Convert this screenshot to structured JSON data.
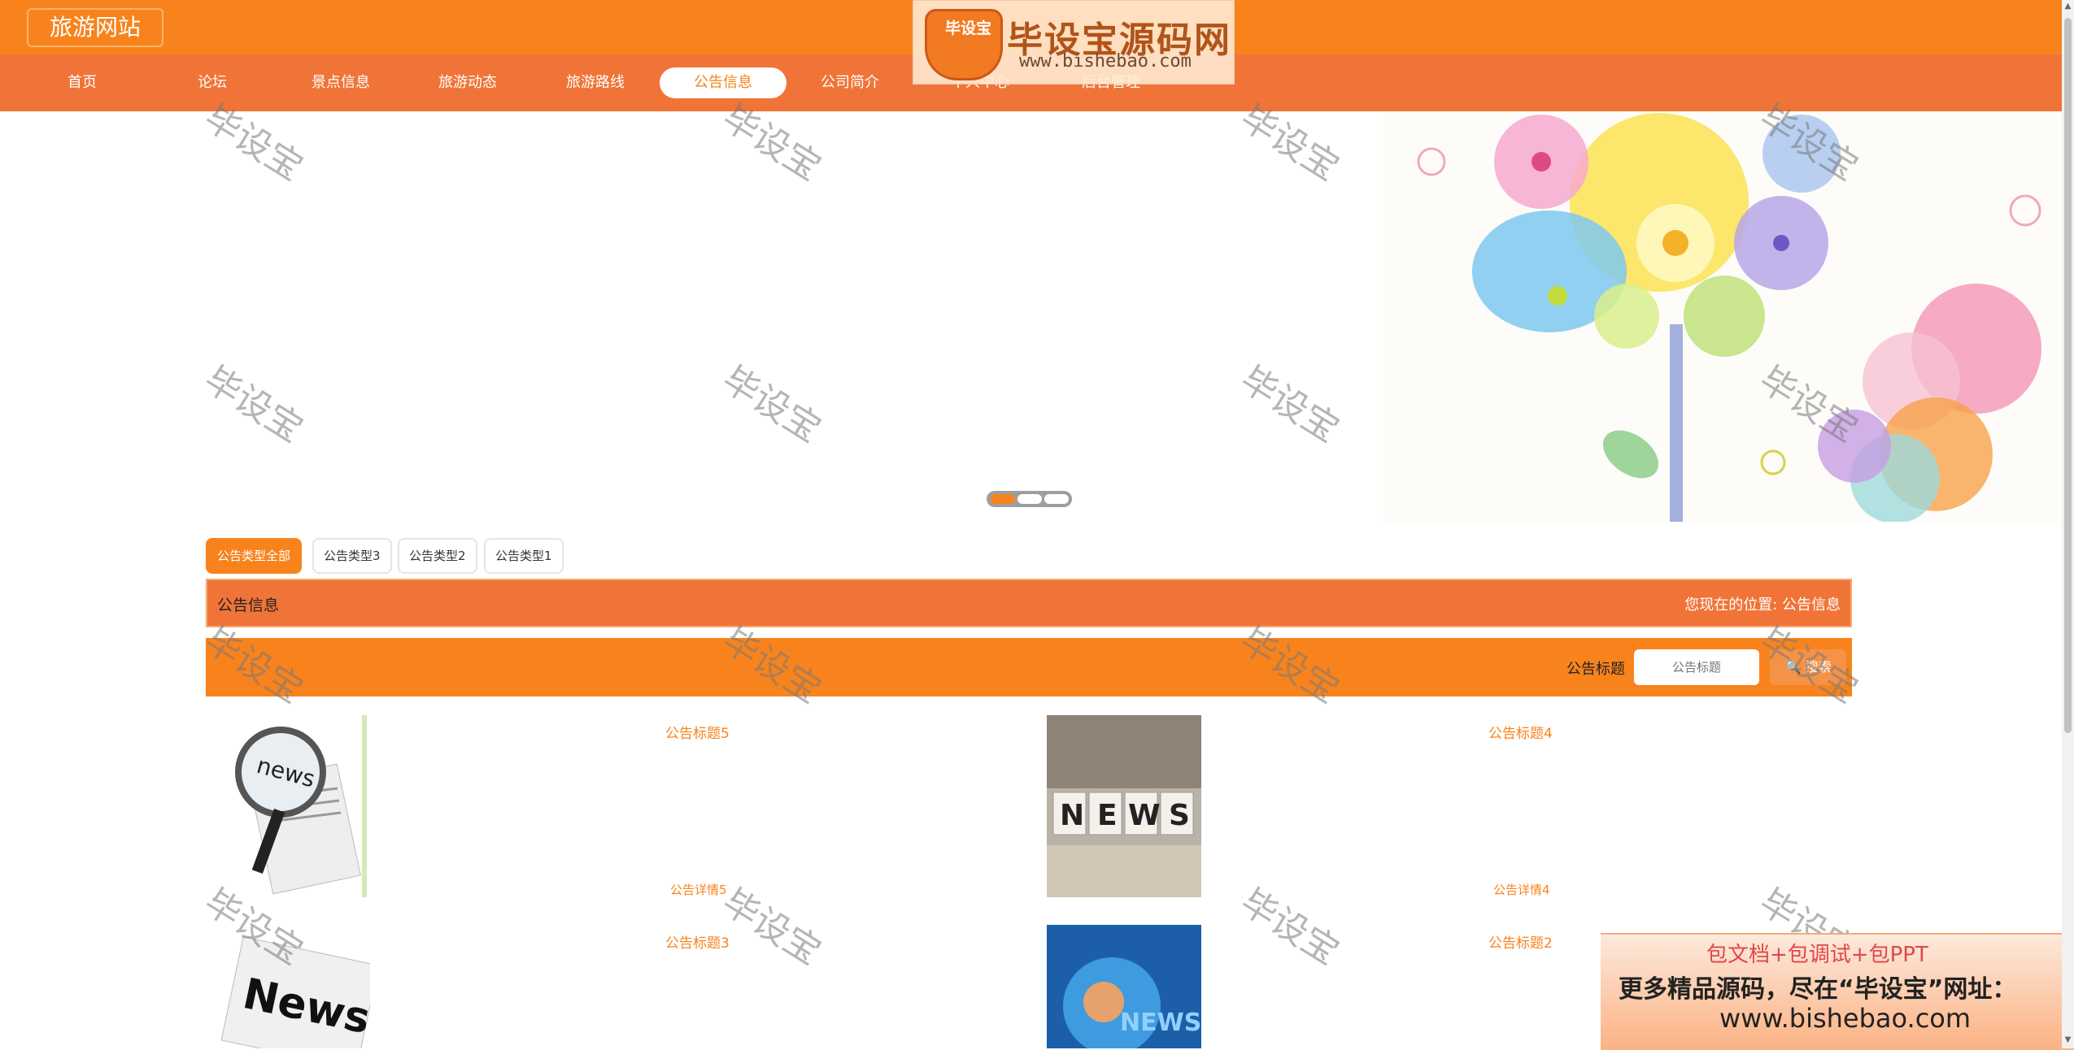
{
  "site": {
    "logo_text": "旅游网站"
  },
  "nav": [
    {
      "label": "首页",
      "active": false
    },
    {
      "label": "论坛",
      "active": false
    },
    {
      "label": "景点信息",
      "active": false
    },
    {
      "label": "旅游动态",
      "active": false
    },
    {
      "label": "旅游路线",
      "active": false
    },
    {
      "label": "公告信息",
      "active": true
    },
    {
      "label": "公司简介",
      "active": false
    },
    {
      "label": "个人中心",
      "active": false
    },
    {
      "label": "后台管理",
      "active": false
    }
  ],
  "top_watermark": {
    "badge": "毕设宝",
    "title": "毕设宝源码网",
    "url": "www.bishebao.com"
  },
  "banner": {
    "slide_count": 3,
    "active_slide": 1
  },
  "categories": [
    {
      "label": "公告类型全部",
      "active": true
    },
    {
      "label": "公告类型3",
      "active": false
    },
    {
      "label": "公告类型2",
      "active": false
    },
    {
      "label": "公告类型1",
      "active": false
    }
  ],
  "section": {
    "title": "公告信息",
    "breadcrumb": "您现在的位置: 公告信息"
  },
  "search": {
    "label": "公告标题",
    "placeholder": "公告标题",
    "button": "搜索",
    "icon": "search-icon"
  },
  "notices": [
    {
      "title": "公告标题5",
      "detail": "公告详情5",
      "image": "news-magnifier"
    },
    {
      "title": "公告标题4",
      "detail": "公告详情4",
      "image": "news-dice"
    },
    {
      "title": "公告标题3",
      "detail": "",
      "image": "news-newspaper"
    },
    {
      "title": "公告标题2",
      "detail": "",
      "image": "news-globe"
    }
  ],
  "watermark_text": "毕设宝",
  "ad": {
    "line1": "包文档+包调试+包PPT",
    "line2": "更多精品源码，尽在“毕设宝”网址：",
    "line3": "www.bishebao.com"
  },
  "colors": {
    "primary": "#f8831d",
    "nav_bg": "#f07437",
    "accent_text": "#f8831d"
  }
}
